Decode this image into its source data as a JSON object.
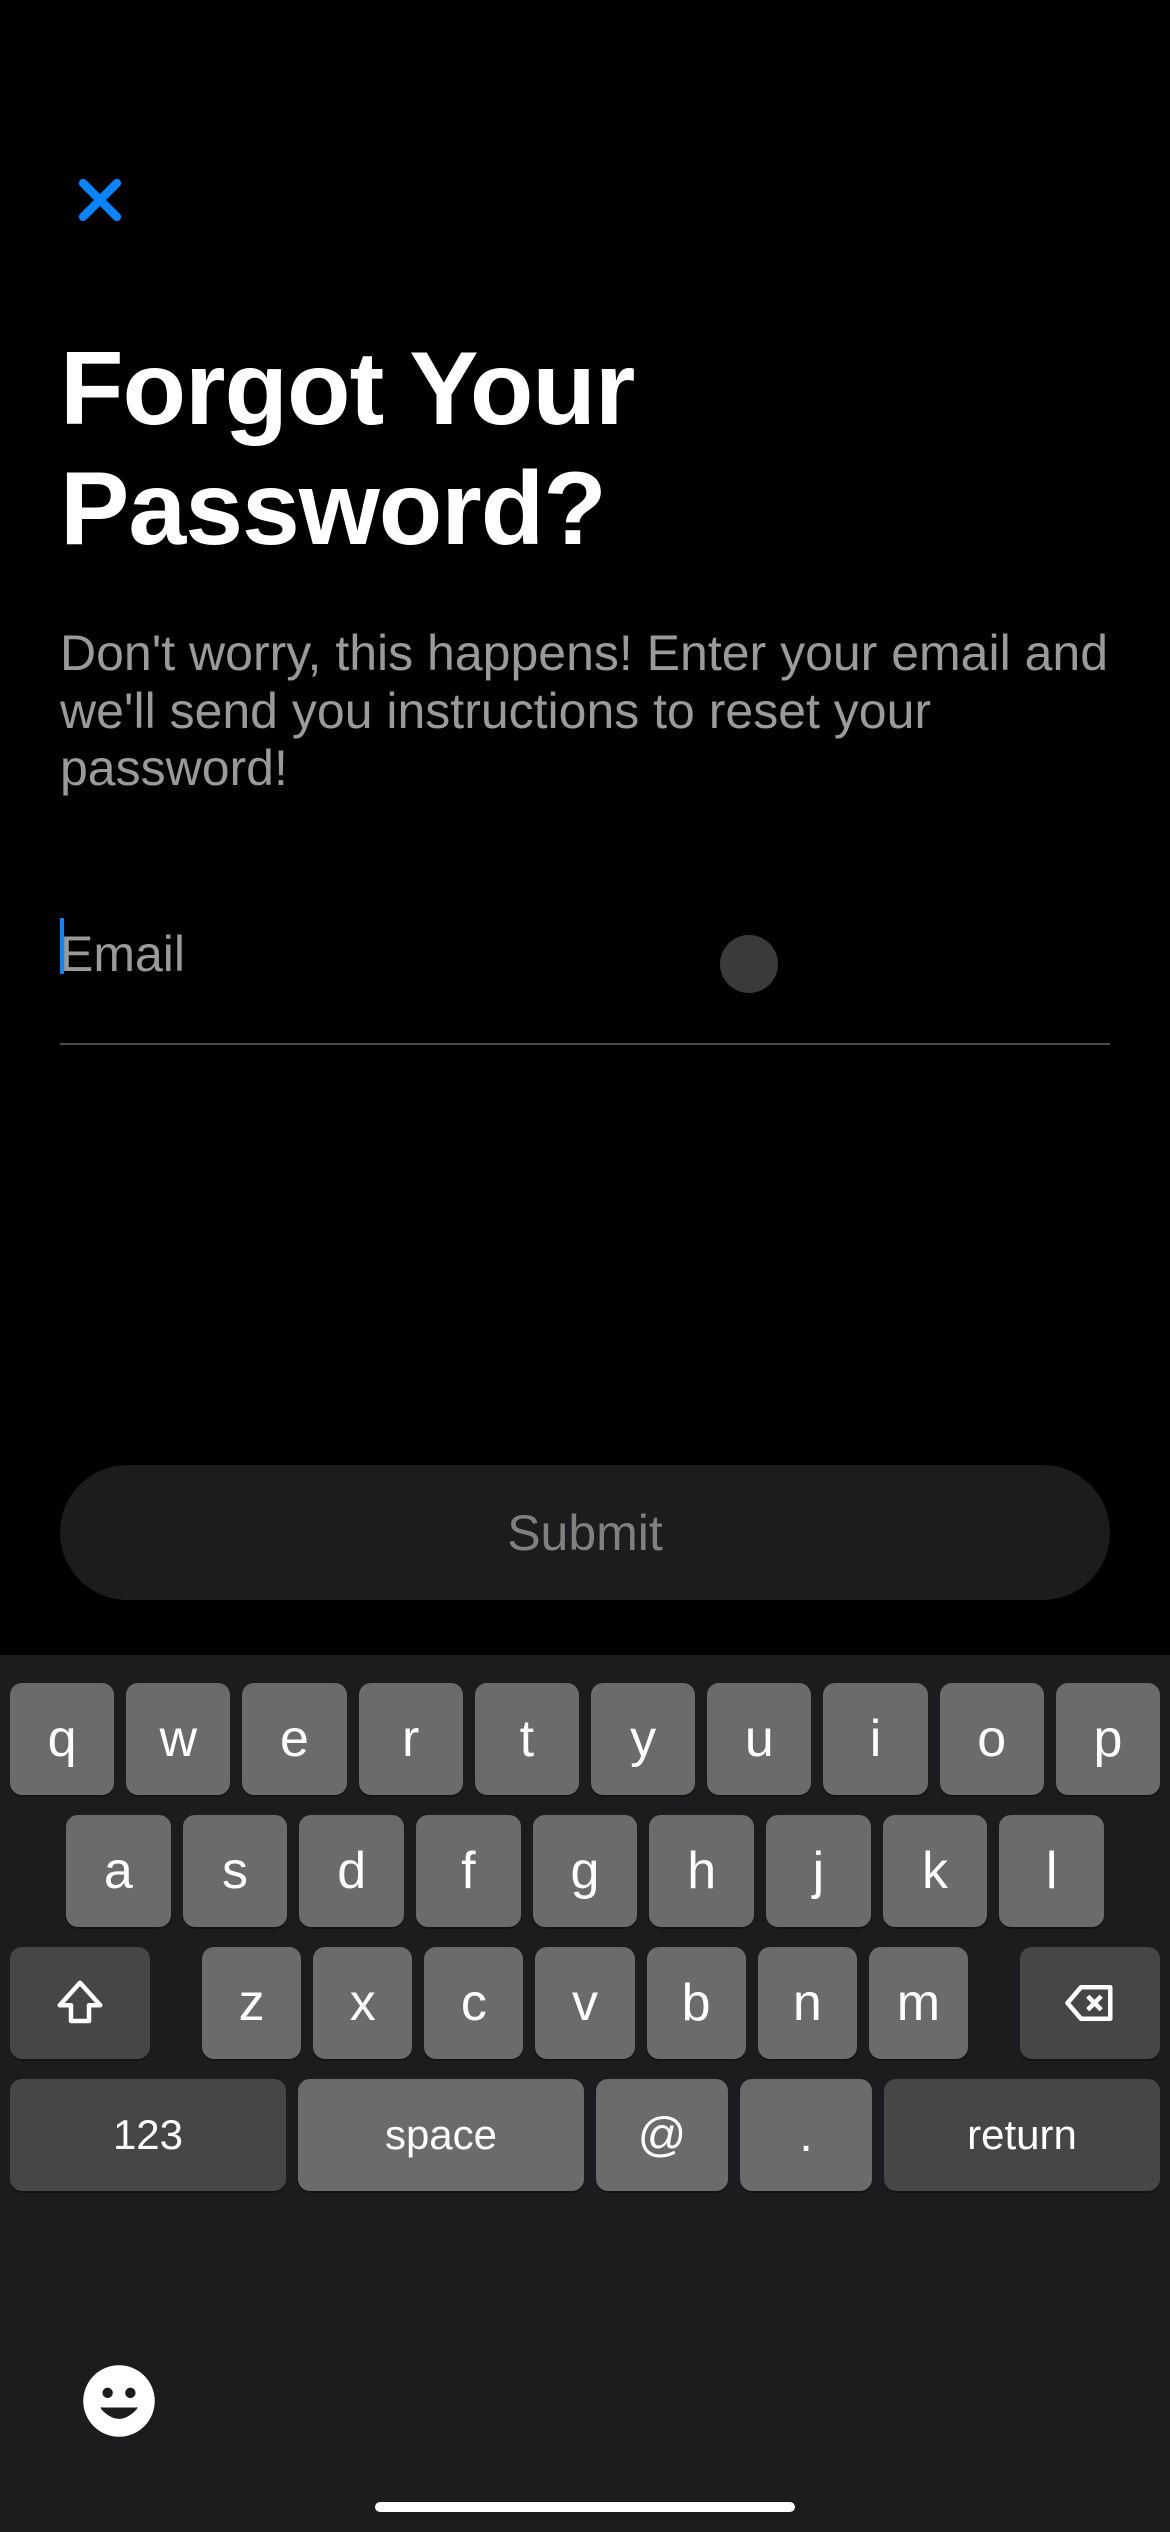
{
  "header": {
    "close_label": "Close"
  },
  "content": {
    "title": "Forgot Your Password?",
    "subtitle": "Don't worry, this happens! Enter your email and we'll send you instructions to reset your password!",
    "email_placeholder": "Email",
    "submit_label": "Submit"
  },
  "keyboard": {
    "row1": [
      "q",
      "w",
      "e",
      "r",
      "t",
      "y",
      "u",
      "i",
      "o",
      "p"
    ],
    "row2": [
      "a",
      "s",
      "d",
      "f",
      "g",
      "h",
      "j",
      "k",
      "l"
    ],
    "row3": [
      "z",
      "x",
      "c",
      "v",
      "b",
      "n",
      "m"
    ],
    "numeric_label": "123",
    "space_label": "space",
    "at_label": "@",
    "dot_label": ".",
    "return_label": "return"
  }
}
